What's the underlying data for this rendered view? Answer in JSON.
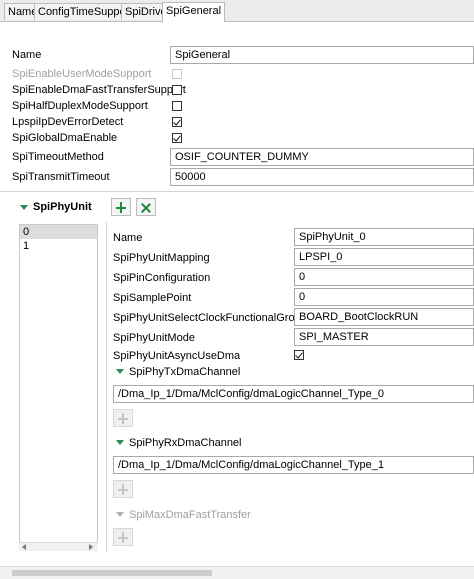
{
  "tabs": [
    {
      "label": "Name"
    },
    {
      "label": "ConfigTimeSupport"
    },
    {
      "label": "SpiDriver"
    },
    {
      "label": "SpiGeneral"
    }
  ],
  "general": {
    "name_label": "Name",
    "name_value": "SpiGeneral",
    "user_mode_label": "SpiEnableUserModeSupport",
    "dma_fast_label": "SpiEnableDmaFastTransferSupport",
    "half_duplex_label": "SpiHalfDuplexModeSupport",
    "dev_error_label": "LpspiIpDevErrorDetect",
    "global_dma_label": "SpiGlobalDmaEnable",
    "timeout_method_label": "SpiTimeoutMethod",
    "timeout_method_value": "OSIF_COUNTER_DUMMY",
    "transmit_timeout_label": "SpiTransmitTimeout",
    "transmit_timeout_value": "50000"
  },
  "phy_unit": {
    "title": "SpiPhyUnit",
    "list_items": [
      "0",
      "1"
    ],
    "name_label": "Name",
    "name_value": "SpiPhyUnit_0",
    "mapping_label": "SpiPhyUnitMapping",
    "mapping_value": "LPSPI_0",
    "pin_config_label": "SpiPinConfiguration",
    "pin_config_value": "0",
    "sample_point_label": "SpiSamplePoint",
    "sample_point_value": "0",
    "clock_group_label": "SpiPhyUnitSelectClockFunctionalGroup",
    "clock_group_value": "BOARD_BootClockRUN",
    "mode_label": "SpiPhyUnitMode",
    "mode_value": "SPI_MASTER",
    "async_dma_label": "SpiPhyUnitAsyncUseDma",
    "tx_dma_title": "SpiPhyTxDmaChannel",
    "tx_dma_value": "/Dma_Ip_1/Dma/MclConfig/dmaLogicChannel_Type_0",
    "rx_dma_title": "SpiPhyRxDmaChannel",
    "rx_dma_value": "/Dma_Ip_1/Dma/MclConfig/dmaLogicChannel_Type_1",
    "max_dma_title": "SpiMaxDmaFastTransfer"
  },
  "checkboxes": {
    "user_mode": false,
    "dma_fast": false,
    "half_duplex": false,
    "dev_error": true,
    "global_dma": true,
    "async_dma": true
  },
  "colors": {
    "accent_green": "#1e8a3e",
    "disabled_text": "#a0a0a0"
  }
}
